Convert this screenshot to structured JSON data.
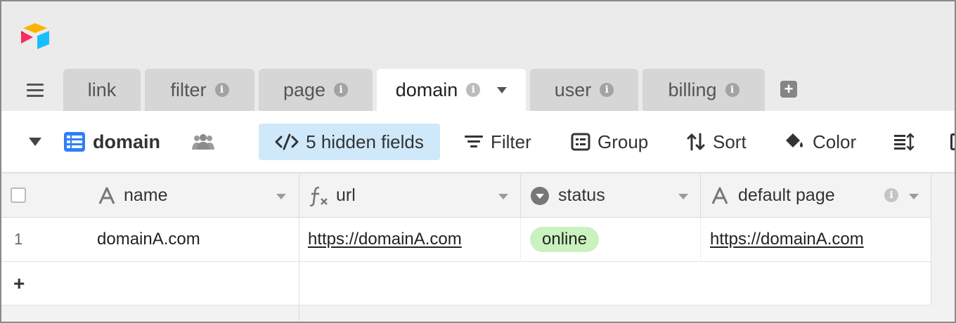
{
  "app": {
    "name": "Airtable"
  },
  "tabs": [
    {
      "label": "link"
    },
    {
      "label": "filter"
    },
    {
      "label": "page"
    },
    {
      "label": "domain",
      "active": true
    },
    {
      "label": "user"
    },
    {
      "label": "billing"
    }
  ],
  "toolbar": {
    "view_name": "domain",
    "hidden_fields": "5 hidden fields",
    "filter": "Filter",
    "group": "Group",
    "sort": "Sort",
    "color": "Color"
  },
  "grid": {
    "columns": [
      {
        "name": "name",
        "icon": "text-icon"
      },
      {
        "name": "url",
        "icon": "formula-icon"
      },
      {
        "name": "status",
        "icon": "single-select-icon"
      },
      {
        "name": "default page",
        "icon": "text-icon"
      }
    ],
    "rows": [
      {
        "number": "1",
        "name": "domainA.com",
        "url": "https://domainA.com",
        "status": "online",
        "default_page": "https://domainA.com"
      }
    ],
    "add_row": "+"
  },
  "colors": {
    "accent_blue": "#2d7ff9",
    "hidden_fields_bg": "#cfe9fa",
    "status_online_bg": "#c9f2be",
    "active_tab_bg": "#ffffff",
    "inactive_tab_bg": "#d6d6d6"
  }
}
